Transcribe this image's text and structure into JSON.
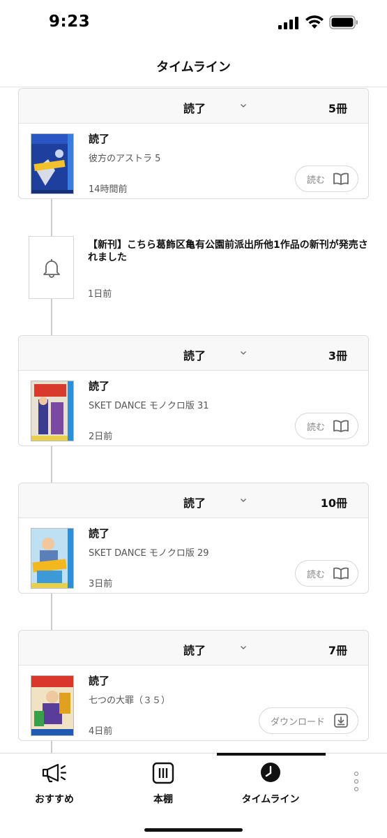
{
  "status_bar": {
    "time": "9:23"
  },
  "header": {
    "title": "タイムライン"
  },
  "timeline": {
    "cards": [
      {
        "status": "読了",
        "count": "5冊",
        "entry_status": "読了",
        "book_title": "彼方のアストラ 5",
        "time": "14時間前",
        "action": "読む",
        "action_icon": "book-open-icon"
      },
      {
        "status": "読了",
        "count": "3冊",
        "entry_status": "読了",
        "book_title": "SKET DANCE モノクロ版 31",
        "time": "2日前",
        "action": "読む",
        "action_icon": "book-open-icon"
      },
      {
        "status": "読了",
        "count": "10冊",
        "entry_status": "読了",
        "book_title": "SKET DANCE モノクロ版 29",
        "time": "3日前",
        "action": "読む",
        "action_icon": "book-open-icon"
      },
      {
        "status": "読了",
        "count": "7冊",
        "entry_status": "読了",
        "book_title": "七つの大罪（３５）",
        "time": "4日前",
        "action": "ダウンロード",
        "action_icon": "download-icon"
      }
    ],
    "notice": {
      "icon": "bell-icon",
      "text": "【新刊】こちら葛飾区亀有公園前派出所他1作品の新刊が発売されました",
      "time": "1日前"
    }
  },
  "tab_bar": {
    "tabs": [
      {
        "label": "おすすめ",
        "icon": "megaphone-icon"
      },
      {
        "label": "本棚",
        "icon": "bookshelf-icon"
      },
      {
        "label": "タイムライン",
        "icon": "clock-icon",
        "active": true
      }
    ],
    "more_icon": "more-vertical-icon"
  }
}
